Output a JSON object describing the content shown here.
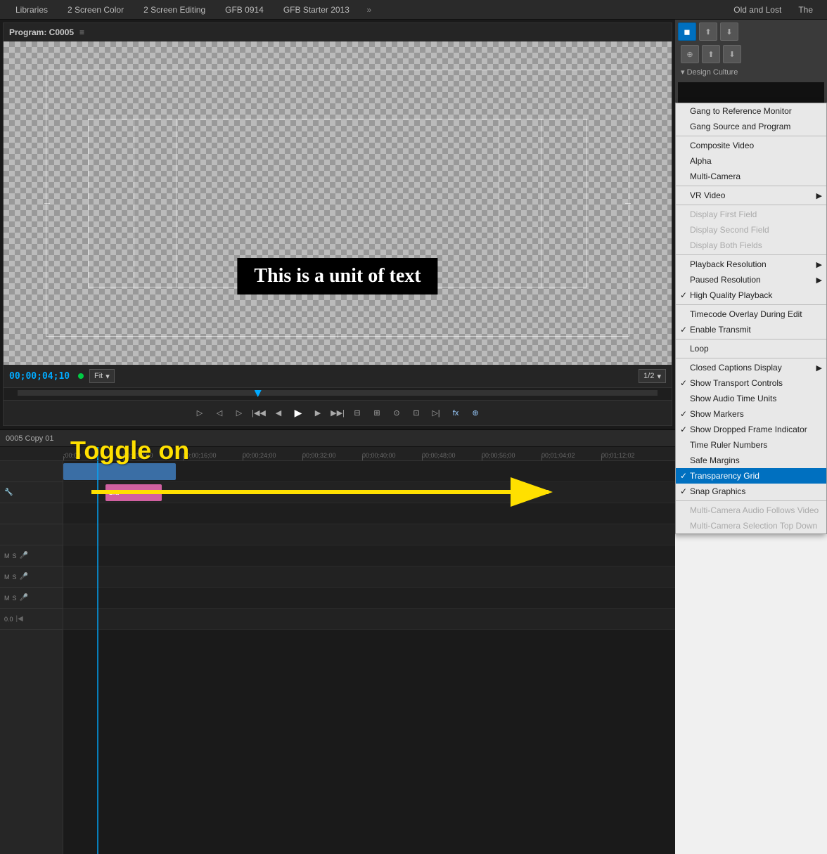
{
  "tabs": {
    "items": [
      {
        "label": "Libraries"
      },
      {
        "label": "2 Screen Color"
      },
      {
        "label": "2 Screen Editing"
      },
      {
        "label": "GFB 0914"
      },
      {
        "label": "GFB Starter 2013"
      }
    ],
    "overflow_label": "»",
    "right_tabs": [
      {
        "label": "Old and Lost"
      },
      {
        "label": "The"
      }
    ]
  },
  "monitor": {
    "title": "Program: C0005",
    "timecode": "00;00;04;10",
    "fit_label": "Fit",
    "ratio_label": "1/2",
    "text_overlay": "This is a unit of text"
  },
  "timeline": {
    "title": "0005 Copy 01",
    "timecodes": [
      ";00:00",
      "00;00;8;00",
      "00;00;16;00",
      "00;00;24;00",
      "00;00;32;00",
      "00;00;40;00",
      "00;00;48;00",
      "00;00;56;00",
      "00;01;04;02",
      "00;01;12;02",
      "00;"
    ],
    "clip_label": "Gra"
  },
  "context_menu": {
    "items": [
      {
        "label": "Gang to Reference Monitor",
        "type": "normal"
      },
      {
        "label": "Gang Source and Program",
        "type": "normal"
      },
      {
        "type": "separator"
      },
      {
        "label": "Composite Video",
        "type": "normal"
      },
      {
        "label": "Alpha",
        "type": "normal"
      },
      {
        "label": "Multi-Camera",
        "type": "normal"
      },
      {
        "type": "separator"
      },
      {
        "label": "VR Video",
        "type": "submenu"
      },
      {
        "type": "separator"
      },
      {
        "label": "Display First Field",
        "type": "disabled"
      },
      {
        "label": "Display Second Field",
        "type": "disabled"
      },
      {
        "label": "Display Both Fields",
        "type": "disabled"
      },
      {
        "type": "separator"
      },
      {
        "label": "Playback Resolution",
        "type": "submenu"
      },
      {
        "label": "Paused Resolution",
        "type": "submenu"
      },
      {
        "label": "High Quality Playback",
        "type": "checked"
      },
      {
        "type": "separator"
      },
      {
        "label": "Timecode Overlay During Edit",
        "type": "normal"
      },
      {
        "label": "Enable Transmit",
        "type": "checked"
      },
      {
        "type": "separator"
      },
      {
        "label": "Loop",
        "type": "normal"
      },
      {
        "type": "separator"
      },
      {
        "label": "Closed Captions Display",
        "type": "submenu"
      },
      {
        "label": "Show Transport Controls",
        "type": "checked"
      },
      {
        "label": "Show Audio Time Units",
        "type": "normal"
      },
      {
        "label": "Show Markers",
        "type": "checked"
      },
      {
        "label": "Show Dropped Frame Indicator",
        "type": "checked"
      },
      {
        "label": "Time Ruler Numbers",
        "type": "normal"
      },
      {
        "label": "Safe Margins",
        "type": "normal"
      },
      {
        "label": "Transparency Grid",
        "type": "highlighted_checked"
      },
      {
        "label": "Snap Graphics",
        "type": "checked"
      },
      {
        "type": "separator"
      },
      {
        "label": "Multi-Camera Audio Follows Video",
        "type": "disabled"
      },
      {
        "label": "Multi-Camera Selection Top Down",
        "type": "disabled"
      }
    ]
  },
  "annotation": {
    "text": "Toggle on"
  }
}
